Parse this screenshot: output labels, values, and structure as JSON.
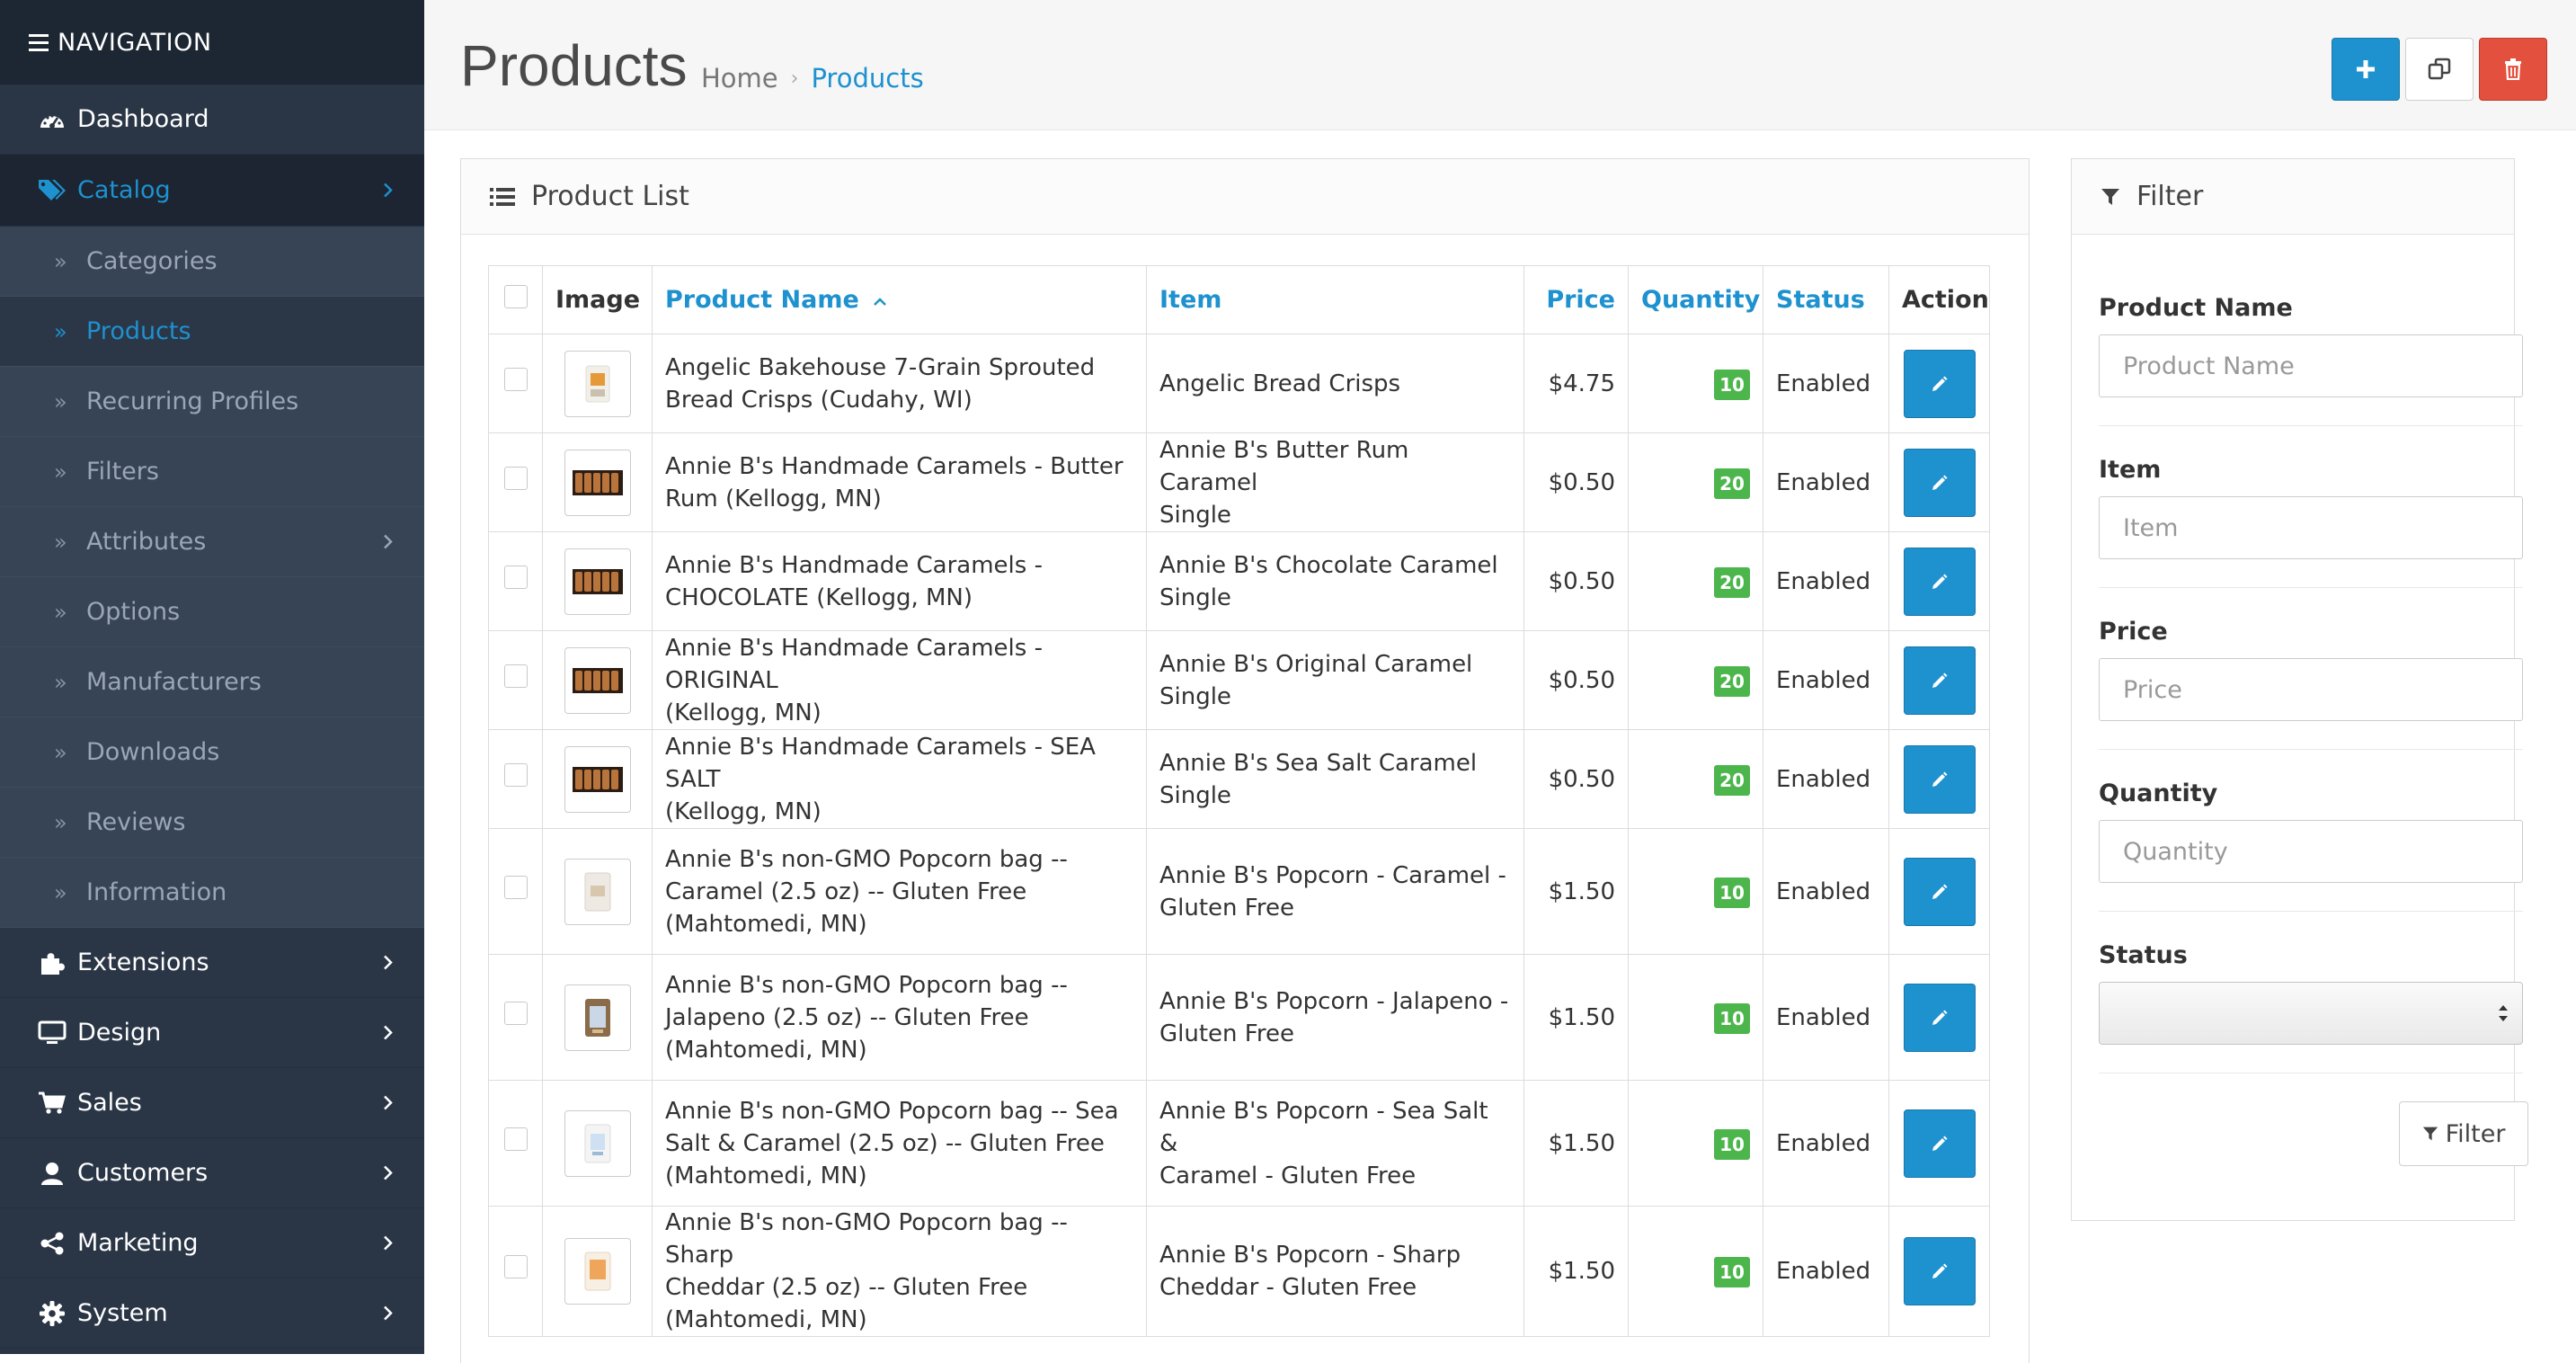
{
  "nav": {
    "header": "NAVIGATION",
    "items": [
      {
        "label": "Dashboard",
        "icon": "dashboard-icon"
      },
      {
        "label": "Catalog",
        "icon": "tags-icon",
        "active": true,
        "children": [
          {
            "label": "Categories"
          },
          {
            "label": "Products",
            "active": true
          },
          {
            "label": "Recurring Profiles"
          },
          {
            "label": "Filters"
          },
          {
            "label": "Attributes",
            "has_children": true
          },
          {
            "label": "Options"
          },
          {
            "label": "Manufacturers"
          },
          {
            "label": "Downloads"
          },
          {
            "label": "Reviews"
          },
          {
            "label": "Information"
          }
        ]
      },
      {
        "label": "Extensions",
        "icon": "puzzle-icon"
      },
      {
        "label": "Design",
        "icon": "monitor-icon"
      },
      {
        "label": "Sales",
        "icon": "cart-icon"
      },
      {
        "label": "Customers",
        "icon": "user-icon"
      },
      {
        "label": "Marketing",
        "icon": "share-icon"
      },
      {
        "label": "System",
        "icon": "gear-icon"
      }
    ]
  },
  "header": {
    "title": "Products",
    "breadcrumb": [
      "Home",
      "Products"
    ],
    "buttons": {
      "add": "plus-icon",
      "copy": "copy-icon",
      "delete": "trash-icon"
    }
  },
  "product_list": {
    "heading": "Product List",
    "columns": {
      "image": "Image",
      "product_name": "Product Name",
      "item": "Item",
      "price": "Price",
      "quantity": "Quantity",
      "status": "Status",
      "action": "Action"
    },
    "rows": [
      {
        "name_lines": [
          "Angelic Bakehouse 7-Grain Sprouted",
          "Bread Crisps (Cudahy, WI)"
        ],
        "item_lines": [
          "Angelic Bread Crisps"
        ],
        "price": "$4.75",
        "quantity": "10",
        "status": "Enabled",
        "thumb": "bag-orange"
      },
      {
        "name_lines": [
          "Annie B's Handmade Caramels - Butter",
          "Rum (Kellogg, MN)"
        ],
        "item_lines": [
          "Annie B's Butter Rum Caramel",
          "Single"
        ],
        "price": "$0.50",
        "quantity": "20",
        "status": "Enabled",
        "thumb": "caramels"
      },
      {
        "name_lines": [
          "Annie B's Handmade Caramels -",
          "CHOCOLATE (Kellogg, MN)"
        ],
        "item_lines": [
          "Annie B's Chocolate Caramel",
          "Single"
        ],
        "price": "$0.50",
        "quantity": "20",
        "status": "Enabled",
        "thumb": "caramels"
      },
      {
        "name_lines": [
          "Annie B's Handmade Caramels - ORIGINAL",
          "(Kellogg, MN)"
        ],
        "item_lines": [
          "Annie B's Original Caramel",
          "Single"
        ],
        "price": "$0.50",
        "quantity": "20",
        "status": "Enabled",
        "thumb": "caramels"
      },
      {
        "name_lines": [
          "Annie B's Handmade Caramels - SEA SALT",
          "(Kellogg, MN)"
        ],
        "item_lines": [
          "Annie B's Sea Salt Caramel",
          "Single"
        ],
        "price": "$0.50",
        "quantity": "20",
        "status": "Enabled",
        "thumb": "caramels"
      },
      {
        "name_lines": [
          "Annie B's non-GMO Popcorn bag --",
          "Caramel (2.5 oz) -- Gluten Free",
          "(Mahtomedi, MN)"
        ],
        "item_lines": [
          "Annie B's Popcorn - Caramel -",
          "Gluten Free"
        ],
        "price": "$1.50",
        "quantity": "10",
        "status": "Enabled",
        "thumb": "popcorn-light"
      },
      {
        "name_lines": [
          "Annie B's non-GMO Popcorn bag --",
          "Jalapeno (2.5 oz) -- Gluten Free",
          "(Mahtomedi, MN)"
        ],
        "item_lines": [
          "Annie B's Popcorn - Jalapeno -",
          "Gluten Free"
        ],
        "price": "$1.50",
        "quantity": "10",
        "status": "Enabled",
        "thumb": "popcorn-dark"
      },
      {
        "name_lines": [
          "Annie B's non-GMO Popcorn bag -- Sea",
          "Salt & Caramel (2.5 oz) -- Gluten Free",
          "(Mahtomedi, MN)"
        ],
        "item_lines": [
          "Annie B's Popcorn - Sea Salt &",
          "Caramel - Gluten Free"
        ],
        "price": "$1.50",
        "quantity": "10",
        "status": "Enabled",
        "thumb": "popcorn-blue"
      },
      {
        "name_lines": [
          "Annie B's non-GMO Popcorn bag -- Sharp",
          "Cheddar (2.5 oz) -- Gluten Free",
          "(Mahtomedi, MN)"
        ],
        "item_lines": [
          "Annie B's Popcorn - Sharp",
          "Cheddar - Gluten Free"
        ],
        "price": "$1.50",
        "quantity": "10",
        "status": "Enabled",
        "thumb": "popcorn-orange"
      }
    ]
  },
  "filter": {
    "heading": "Filter",
    "fields": [
      {
        "label": "Product Name",
        "placeholder": "Product Name"
      },
      {
        "label": "Item",
        "placeholder": "Item"
      },
      {
        "label": "Price",
        "placeholder": "Price"
      },
      {
        "label": "Quantity",
        "placeholder": "Quantity"
      }
    ],
    "status_label": "Status",
    "status_value": "",
    "button_label": "Filter"
  },
  "colors": {
    "sidebar_bg": "#2a3646",
    "accent": "#1e91cf",
    "danger": "#e3503e",
    "badge": "#4cb64c"
  }
}
